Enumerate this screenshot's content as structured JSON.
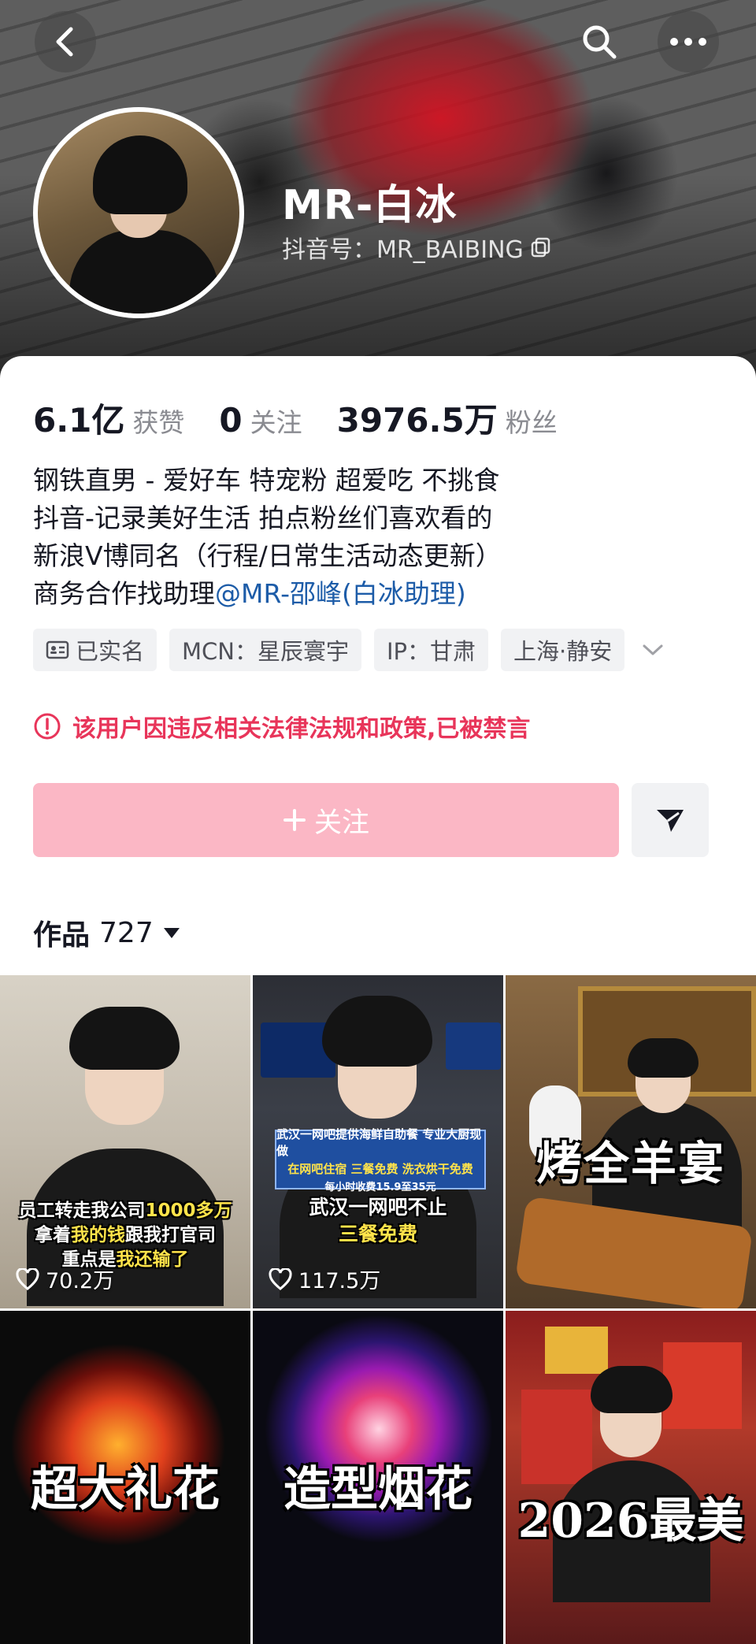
{
  "profile": {
    "nickname": "MR-白冰",
    "douyin_id": "抖音号：MR_BAIBING"
  },
  "stats": [
    {
      "value": "6.1亿",
      "label": "获赞"
    },
    {
      "value": "0",
      "label": "关注"
    },
    {
      "value": "3976.5万",
      "label": "粉丝"
    }
  ],
  "bio": {
    "lines": [
      "钢铁直男 - 爱好车 特宠粉 超爱吃 不挑食",
      "抖音-记录美好生活 拍点粉丝们喜欢看的",
      "新浪V博同名（行程/日常生活动态更新）"
    ],
    "line4_prefix": "商务合作找助理",
    "line4_mention": "@MR-邵峰(白冰助理)"
  },
  "tags": {
    "verified": "已实名",
    "mcn": "MCN：星辰寰宇",
    "ip": "IP：甘肃",
    "location": "上海·静安"
  },
  "ban_notice": "该用户因违反相关法律法规和政策,已被禁言",
  "actions": {
    "follow_label": "关注"
  },
  "works": {
    "label": "作品",
    "count": "727"
  },
  "videos": [
    {
      "caption_lines": [
        "员工转走我公司",
        "1000多万",
        "拿着",
        "我的钱",
        "跟我打官司",
        "重点是",
        "我还输了"
      ],
      "likes": "70.2万"
    },
    {
      "banner_lines": [
        "武汉一网吧提供海鲜自助餐 专业大厨现做",
        "在网吧住宿 三餐免费 洗衣烘干免费",
        "每小时收费15.9至35元"
      ],
      "caption_lines": [
        "武汉一网吧不止",
        "三餐免费"
      ],
      "likes": "117.5万"
    },
    {
      "caption": "烤全羊宴"
    },
    {
      "caption": "超大礼花"
    },
    {
      "caption": "造型烟花"
    },
    {
      "caption": "2026最美"
    }
  ],
  "colors": {
    "accent_pink": "#fbb7c5",
    "ban_red": "#e8355a",
    "mention_blue": "#1d5ca8"
  }
}
